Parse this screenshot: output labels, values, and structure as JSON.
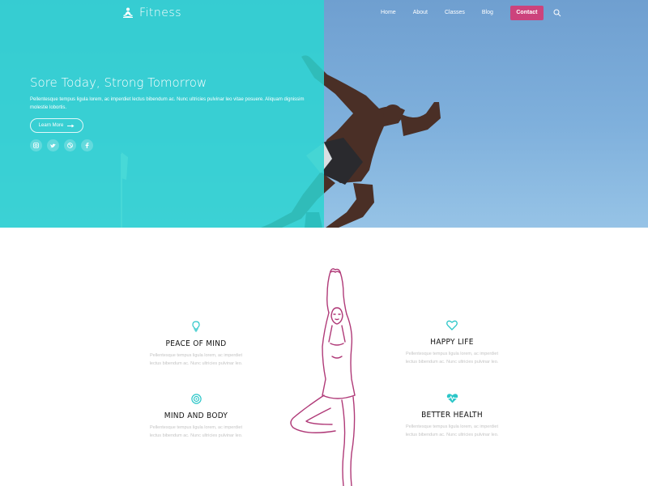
{
  "brand": {
    "name": "Fitness",
    "icon": "meditation-icon"
  },
  "nav": {
    "links": [
      "Home",
      "About",
      "Classes",
      "Blog"
    ],
    "cta": "Contact",
    "search_icon": "search-icon"
  },
  "hero": {
    "title": "Sore Today, Strong Tomorrow",
    "text": "Pellentesque tempus ligula lorem, ac imperdiet lectus bibendum ac. Nunc ultricies pulvinar leo vitae posuere. Aliquam dignissim molestie lobortis.",
    "button": "Learn More",
    "socials": [
      "instagram-icon",
      "twitter-icon",
      "dribbble-icon",
      "facebook-icon"
    ]
  },
  "features": [
    {
      "title": "PEACE OF MIND",
      "text1": "Pellentesque tempus ligula lorem, ac imperdiet",
      "text2": "lectus bibendum ac. Nunc ultricies pulvinar leo.",
      "icon": "lightbulb-icon"
    },
    {
      "title": "HAPPY LIFE",
      "text1": "Pellentesque tempus ligula lorem, ac imperdiet",
      "text2": "lectus bibendum ac. Nunc ultricies pulvinar leo.",
      "icon": "heart-icon"
    },
    {
      "title": "MIND AND BODY",
      "text1": "Pellentesque tempus ligula lorem, ac imperdiet",
      "text2": "lectus bibendum ac. Nunc ultricies pulvinar leo.",
      "icon": "target-icon"
    },
    {
      "title": "BETTER HEALTH",
      "text1": "Pellentesque tempus ligula lorem, ac imperdiet",
      "text2": "lectus bibendum ac. Nunc ultricies pulvinar leo.",
      "icon": "heartbeat-icon"
    }
  ],
  "colors": {
    "accent_teal": "#2cd4d2",
    "cta_pink": "#cc437c",
    "yoga_line": "#b03a78",
    "icon_teal": "#2bc6c8"
  }
}
